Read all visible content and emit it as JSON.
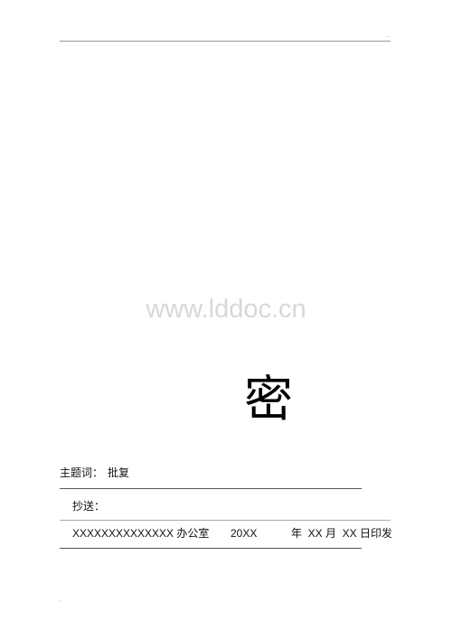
{
  "header": {
    "mark": ".."
  },
  "watermark": {
    "text": "www.lddoc.cn"
  },
  "classification": {
    "char": "密"
  },
  "subject": {
    "label": "主题词：",
    "value": "批复"
  },
  "cc": {
    "label": "抄送："
  },
  "issue": {
    "issuer": "XXXXXXXXXXXXXX 办公室",
    "year": "20XX",
    "date_tail": "年  XX 月  XX 日印发"
  },
  "footer": {
    "mark": "."
  }
}
